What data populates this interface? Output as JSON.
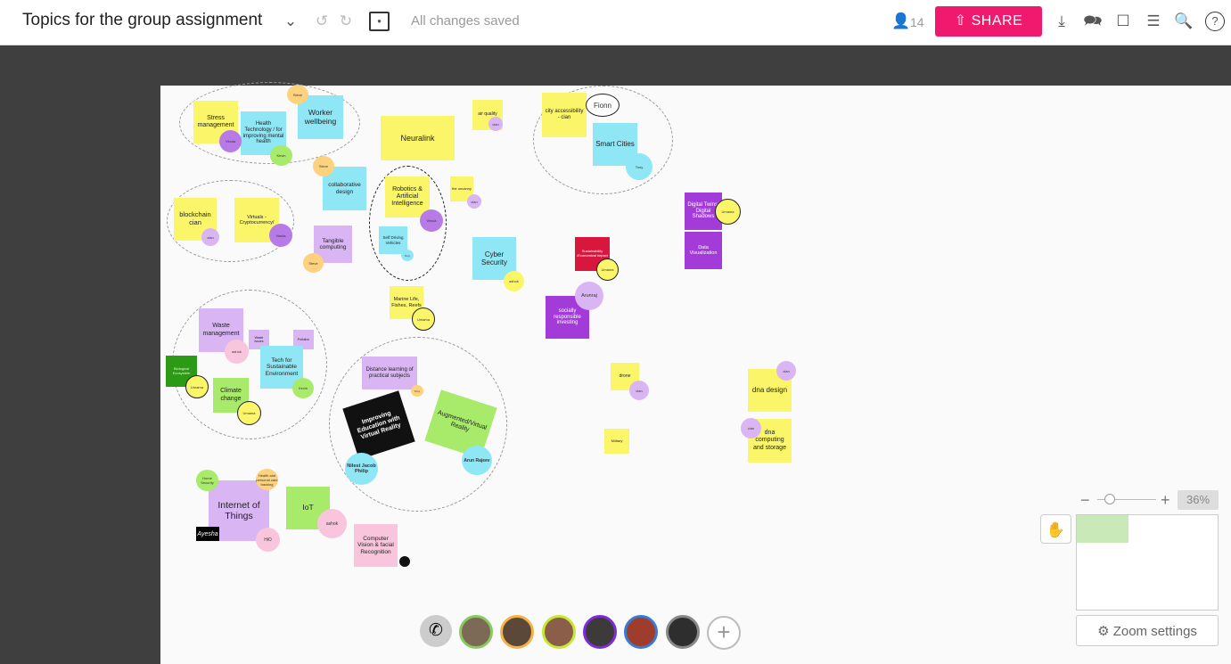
{
  "header": {
    "title": "Topics for the group assignment",
    "saved_status": "All changes saved",
    "user_count": "14",
    "share_label": "SHARE"
  },
  "notes": [
    {
      "id": "stress",
      "text": "Stress management"
    },
    {
      "id": "health",
      "text": "Health Technology / for improving mental health"
    },
    {
      "id": "worker",
      "text": "Worker wellbeing"
    },
    {
      "id": "neuralink",
      "text": "Neuralink"
    },
    {
      "id": "air",
      "text": "air quality"
    },
    {
      "id": "cityacc",
      "text": "city accessibility - cian"
    },
    {
      "id": "smart",
      "text": "Smart Cities"
    },
    {
      "id": "collab",
      "text": "collaborative design"
    },
    {
      "id": "robotics",
      "text": "Robotics & Artificial Intelligence"
    },
    {
      "id": "uncanny",
      "text": "the uncanny"
    },
    {
      "id": "blockchain",
      "text": "blockchain cian"
    },
    {
      "id": "virtuals",
      "text": "Virtuals - Cryptocurrency/"
    },
    {
      "id": "tangible",
      "text": "Tangible computing"
    },
    {
      "id": "selfdriving",
      "text": "Self Driving Vehicles"
    },
    {
      "id": "cyber",
      "text": "Cyber Security"
    },
    {
      "id": "digitaltwins",
      "text": "Digital Twins/ Digital Shadows"
    },
    {
      "id": "dataviz",
      "text": "Data Visualization"
    },
    {
      "id": "sustain",
      "text": "Sustainability /Economical impact"
    },
    {
      "id": "marine",
      "text": "Marine Life, Fishes, Reefs"
    },
    {
      "id": "social",
      "text": "socially responsible investing"
    },
    {
      "id": "waste",
      "text": "Waste management"
    },
    {
      "id": "wastesmall",
      "text": "Waste issues"
    },
    {
      "id": "pollution",
      "text": "Pollution"
    },
    {
      "id": "techsust",
      "text": "Tech for Sustainable Environment"
    },
    {
      "id": "bio",
      "text": "Biological Ecosystem"
    },
    {
      "id": "climate",
      "text": "Climate change"
    },
    {
      "id": "distance",
      "text": "Distance learning of practical subjects"
    },
    {
      "id": "improving",
      "text": "Improving Education with Virtual Reality"
    },
    {
      "id": "ar",
      "text": "Augmented/Virtual Reality"
    },
    {
      "id": "drone",
      "text": "drone"
    },
    {
      "id": "military",
      "text": "Military"
    },
    {
      "id": "dnadesign",
      "text": "dna design"
    },
    {
      "id": "dnacomp",
      "text": "dna computing and storage"
    },
    {
      "id": "iot",
      "text": "Internet of Things"
    },
    {
      "id": "iot2",
      "text": "IoT"
    },
    {
      "id": "cv",
      "text": "Computer Vision & facial Recognition"
    }
  ],
  "dots": [
    {
      "id": "fionn",
      "text": "Fionn"
    },
    {
      "id": "tony",
      "text": "Tony"
    },
    {
      "id": "arunraj",
      "text": "Arunraj"
    },
    {
      "id": "nilest",
      "text": "Nilest Jacob Philip"
    },
    {
      "id": "arun",
      "text": "Arun Rajeev"
    },
    {
      "id": "ashok1",
      "text": "ashok"
    },
    {
      "id": "ashok2",
      "text": "ashok"
    },
    {
      "id": "ashok3",
      "text": "ashok"
    },
    {
      "id": "hio",
      "text": "HiO"
    },
    {
      "id": "ayesha",
      "text": "Ayesha"
    },
    {
      "id": "vinula1",
      "text": "Vinula"
    },
    {
      "id": "vinula2",
      "text": "Vinula"
    },
    {
      "id": "vinula3",
      "text": "Vinula"
    },
    {
      "id": "steve1",
      "text": "Steve"
    },
    {
      "id": "steve2",
      "text": "Steve"
    },
    {
      "id": "steve3",
      "text": "Steve"
    },
    {
      "id": "kevin1",
      "text": "Kevin"
    },
    {
      "id": "kevin2",
      "text": "Kevin"
    },
    {
      "id": "cian1",
      "text": "cian"
    },
    {
      "id": "cian2",
      "text": "cian"
    },
    {
      "id": "cian3",
      "text": "cian"
    },
    {
      "id": "cian4",
      "text": "cian"
    },
    {
      "id": "cian5",
      "text": "cian"
    },
    {
      "id": "cian6",
      "text": "cian"
    },
    {
      "id": "umama1",
      "text": "Umama"
    },
    {
      "id": "umama2",
      "text": "Umama"
    },
    {
      "id": "umama3",
      "text": "Umama"
    },
    {
      "id": "umama4",
      "text": "Umama"
    },
    {
      "id": "umama5",
      "text": "Umama"
    },
    {
      "id": "homesec",
      "text": "Home Security"
    },
    {
      "id": "health2",
      "text": "Health and personal care tracking"
    },
    {
      "id": "tony2",
      "text": "Tony"
    },
    {
      "id": "tony3",
      "text": "Tony"
    },
    {
      "id": "ravi",
      "text": "Ravi"
    }
  ],
  "zoom": {
    "level": "36%",
    "settings_label": "Zoom settings"
  },
  "colors": {
    "accent": "#f0196e",
    "canvas": "#fafafa",
    "stage": "#3f3f3f"
  }
}
